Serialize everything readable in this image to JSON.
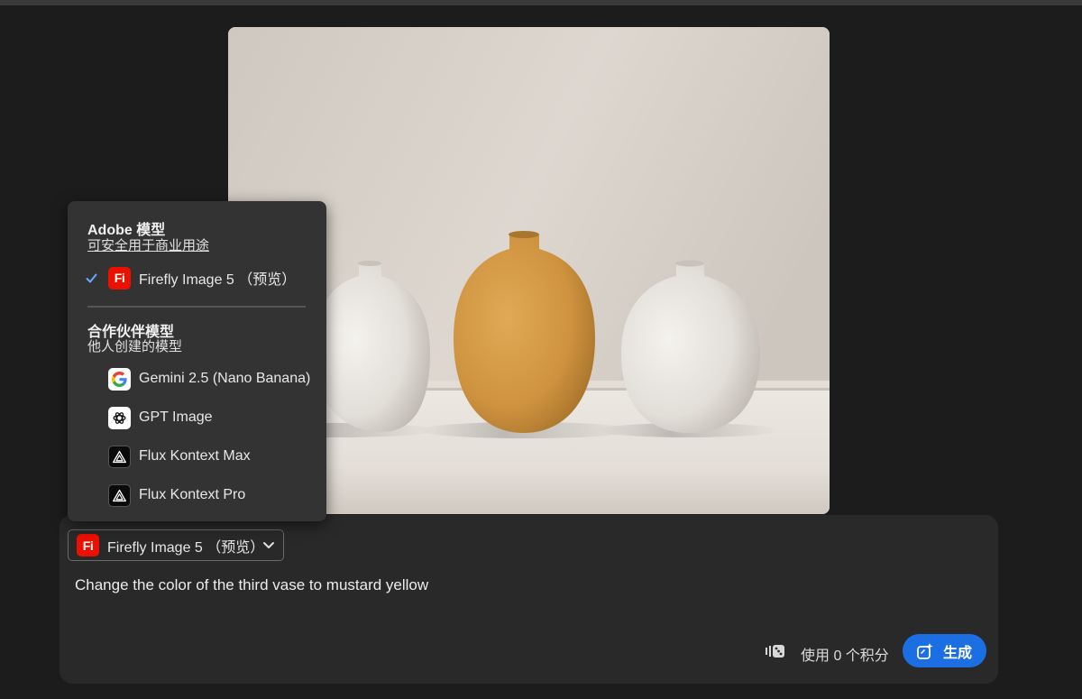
{
  "colors": {
    "background": "#1c1c1c",
    "panel": "#292929",
    "menu": "#333333",
    "accent_blue": "#1b6fe3",
    "firefly_red": "#eb1000",
    "check_blue": "#6aa8ff"
  },
  "menu": {
    "adobe_heading": "Adobe 模型",
    "adobe_subheading": "可安全用于商业用途",
    "adobe_models": [
      {
        "label": "Firefly Image 5 （预览）",
        "icon": "firefly-fi-logo",
        "selected": true
      }
    ],
    "partner_heading": "合作伙伴模型",
    "partner_subheading": "他人创建的模型",
    "partner_models": [
      {
        "label": "Gemini 2.5 (Nano Banana)",
        "icon": "google-g-icon"
      },
      {
        "label": "GPT Image",
        "icon": "openai-icon"
      },
      {
        "label": "Flux Kontext Max",
        "icon": "flux-icon"
      },
      {
        "label": "Flux Kontext Pro",
        "icon": "flux-icon"
      }
    ]
  },
  "model_select": {
    "logo_text": "Fi",
    "label": "Firefly Image 5 （预览）",
    "icon": "chevron-down-icon"
  },
  "prompt": {
    "text": "Change the color of the third vase to mustard yellow"
  },
  "footer": {
    "credits_text": "使用 0 个积分",
    "credits_icon": "dice-icon",
    "generate_label": "生成",
    "generate_icon": "generate-sparkle-icon"
  }
}
